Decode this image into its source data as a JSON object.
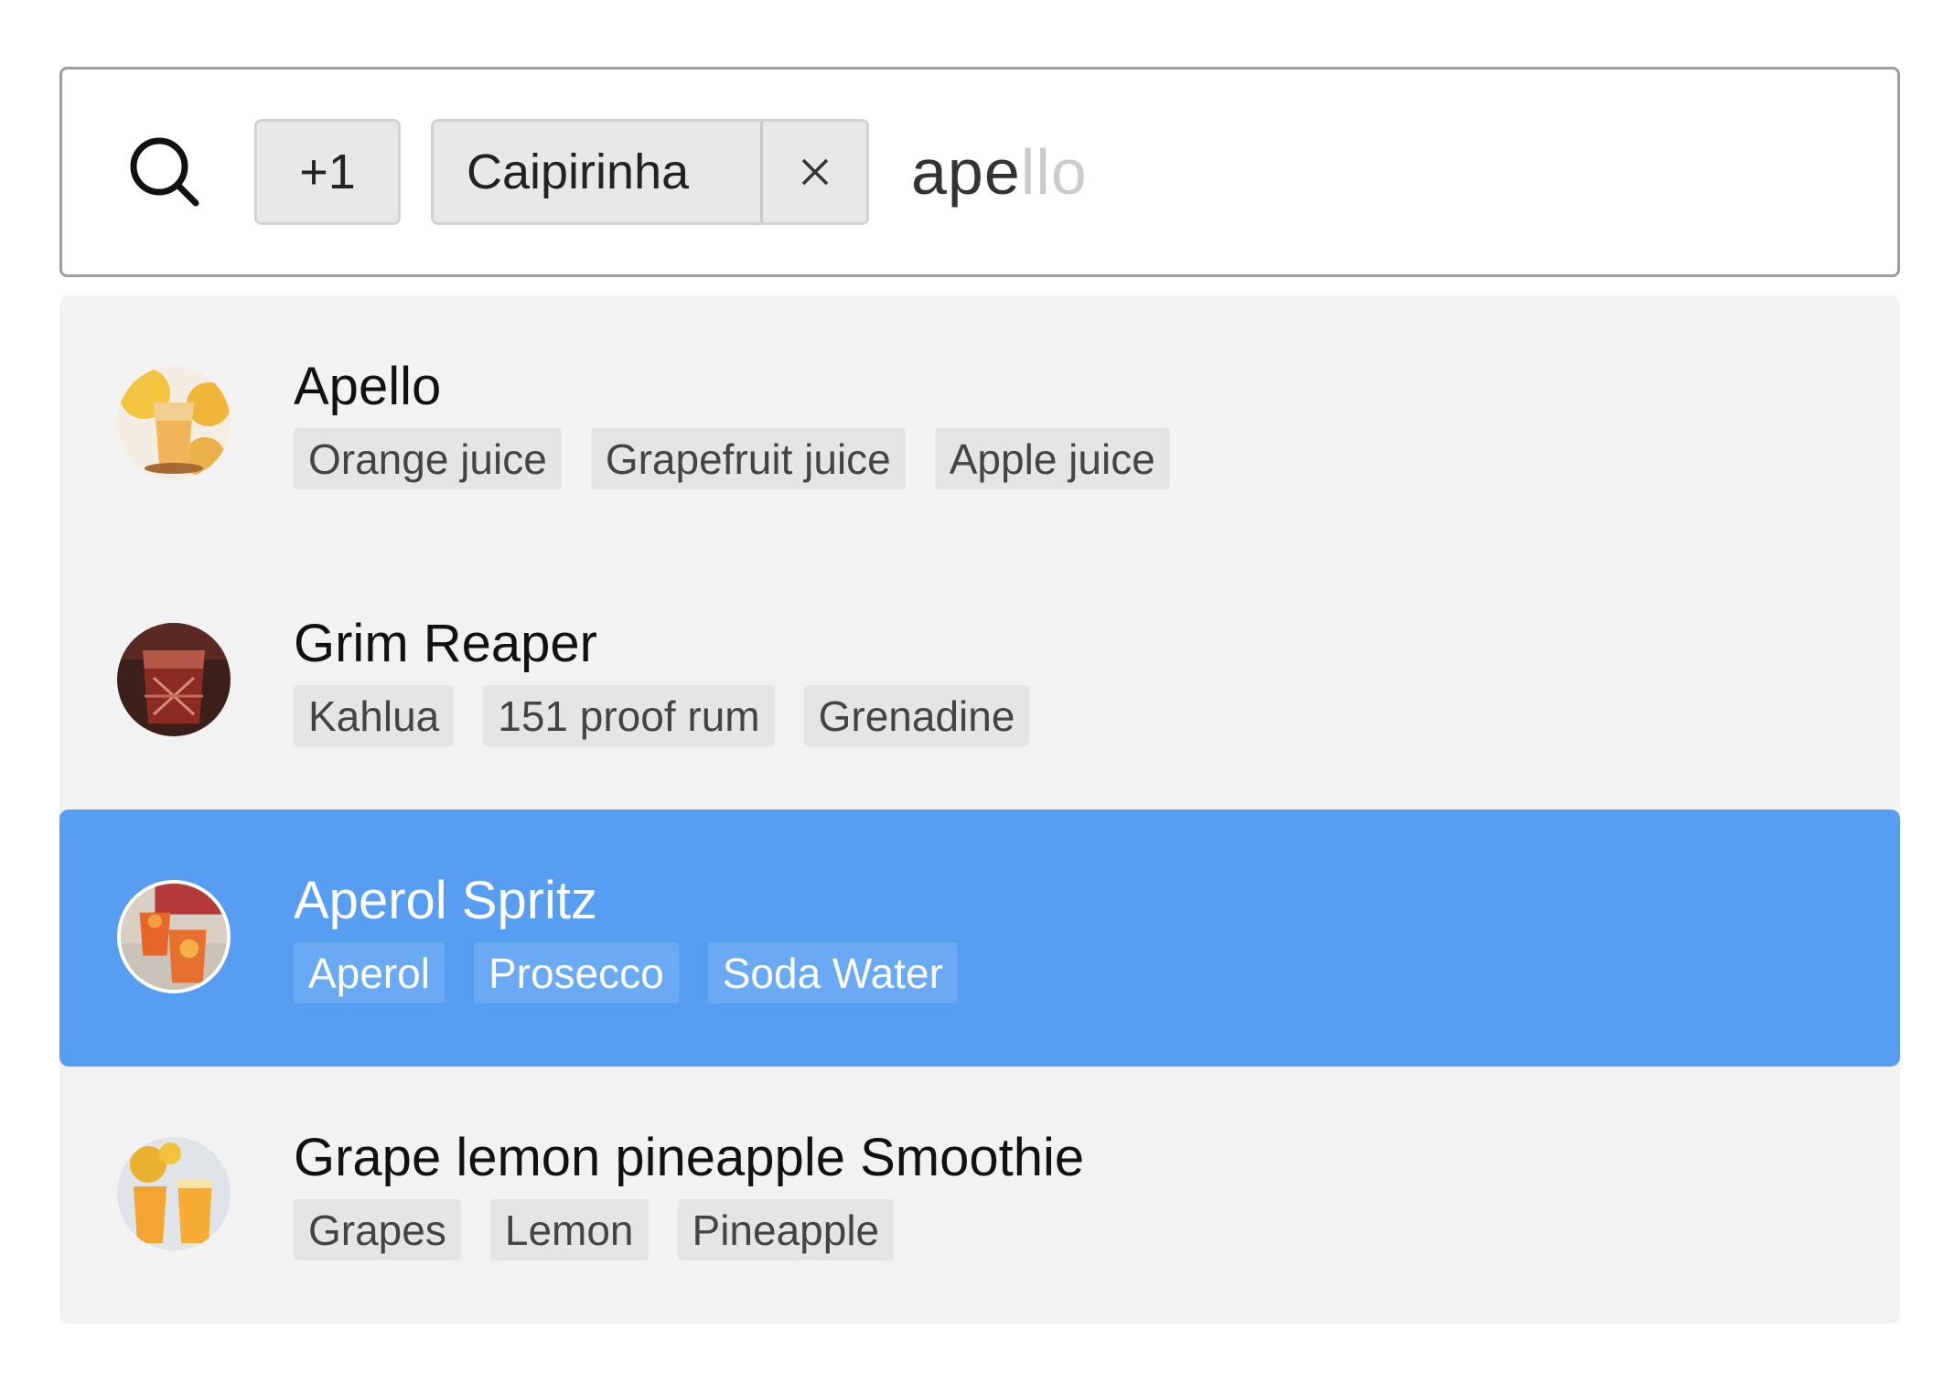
{
  "search": {
    "typed": "ape",
    "completion_hint": "llo",
    "more_count_label": "+1",
    "selected_tags": [
      {
        "label": "Caipirinha",
        "remove_glyph": "×"
      }
    ]
  },
  "results": [
    {
      "title": "Apello",
      "selected": false,
      "image_icon": "orange-juice-thumbnail",
      "ingredients": [
        "Orange juice",
        "Grapefruit juice",
        "Apple juice"
      ]
    },
    {
      "title": "Grim Reaper",
      "selected": false,
      "image_icon": "dark-cocktail-thumbnail",
      "ingredients": [
        "Kahlua",
        "151 proof rum",
        "Grenadine"
      ]
    },
    {
      "title": "Aperol Spritz",
      "selected": true,
      "image_icon": "aperol-spritz-thumbnail",
      "ingredients": [
        "Aperol",
        "Prosecco",
        "Soda Water"
      ]
    },
    {
      "title": "Grape lemon pineapple Smoothie",
      "selected": false,
      "image_icon": "smoothie-thumbnail",
      "ingredients": [
        "Grapes",
        "Lemon",
        "Pineapple"
      ]
    }
  ],
  "colors": {
    "selected_row": "#579ef2",
    "list_background": "#f2f2f2",
    "chip_background": "#e8e8e8"
  }
}
